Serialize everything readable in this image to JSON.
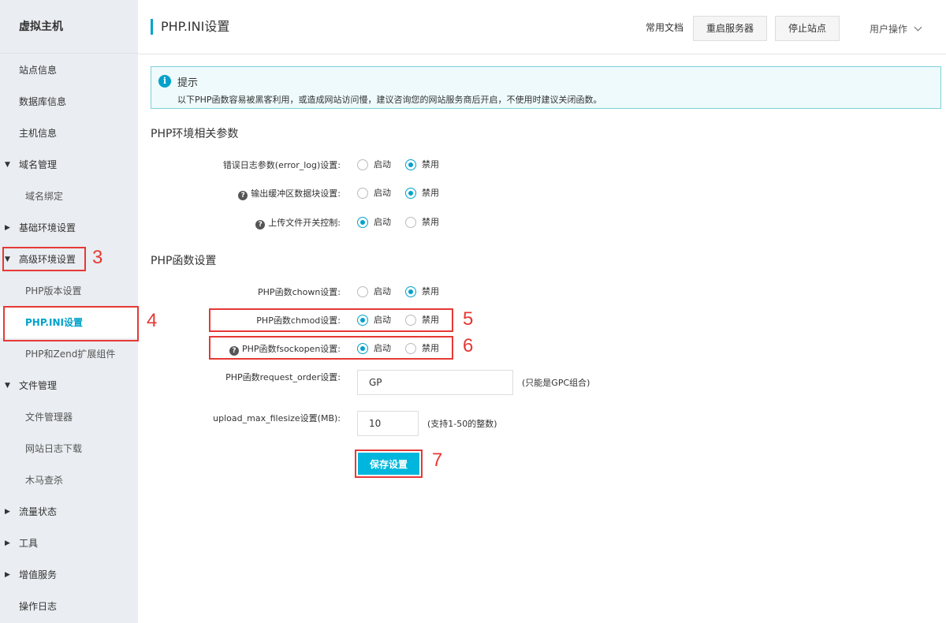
{
  "sidebar": {
    "title": "虚拟主机",
    "items": [
      {
        "label": "站点信息"
      },
      {
        "label": "数据库信息"
      },
      {
        "label": "主机信息"
      },
      {
        "label": "域名管理"
      },
      {
        "label": "域名绑定"
      },
      {
        "label": "基础环境设置"
      },
      {
        "label": "高级环境设置"
      },
      {
        "label": "PHP版本设置"
      },
      {
        "label": "PHP.INI设置"
      },
      {
        "label": "PHP和Zend扩展组件"
      },
      {
        "label": "文件管理"
      },
      {
        "label": "文件管理器"
      },
      {
        "label": "网站日志下载"
      },
      {
        "label": "木马查杀"
      },
      {
        "label": "流量状态"
      },
      {
        "label": "工具"
      },
      {
        "label": "增值服务"
      },
      {
        "label": "操作日志"
      }
    ]
  },
  "header": {
    "title": "PHP.INI设置",
    "docs_link": "常用文档",
    "restart_btn": "重启服务器",
    "stop_btn": "停止站点",
    "user_menu": "用户操作"
  },
  "tip": {
    "icon": "info-icon",
    "title": "提示",
    "text": "以下PHP函数容易被黑客利用，或造成网站访问慢，建议咨询您的网站服务商后开启，不使用时建议关闭函数。"
  },
  "sections": {
    "env_title": "PHP环境相关参数",
    "func_title": "PHP函数设置"
  },
  "radio_labels": {
    "on": "启动",
    "off": "禁用"
  },
  "env_rows": [
    {
      "label": "错误日志参数(error_log)设置:",
      "selected": "off"
    },
    {
      "label": "输出缓冲区数据块设置:",
      "selected": "off"
    },
    {
      "label": "上传文件开关控制:",
      "selected": "on"
    }
  ],
  "func_rows": [
    {
      "label": "PHP函数chown设置:",
      "selected": "off"
    },
    {
      "label": "PHP函数chmod设置:",
      "selected": "on"
    },
    {
      "label": "PHP函数fsockopen设置:",
      "selected": "on"
    }
  ],
  "request_order": {
    "label": "PHP函数request_order设置:",
    "value": "GP",
    "hint": "(只能是GPC组合)"
  },
  "upload_max": {
    "label": "upload_max_filesize设置(MB):",
    "value": "10",
    "hint": "(支持1-50的整数)"
  },
  "save_btn": "保存设置",
  "annotations": [
    "3",
    "4",
    "5",
    "6",
    "7"
  ],
  "colors": {
    "accent": "#00a2ca",
    "button": "#00b6dc",
    "annotation": "#e53935",
    "sidebar_bg": "#eaedf1"
  }
}
